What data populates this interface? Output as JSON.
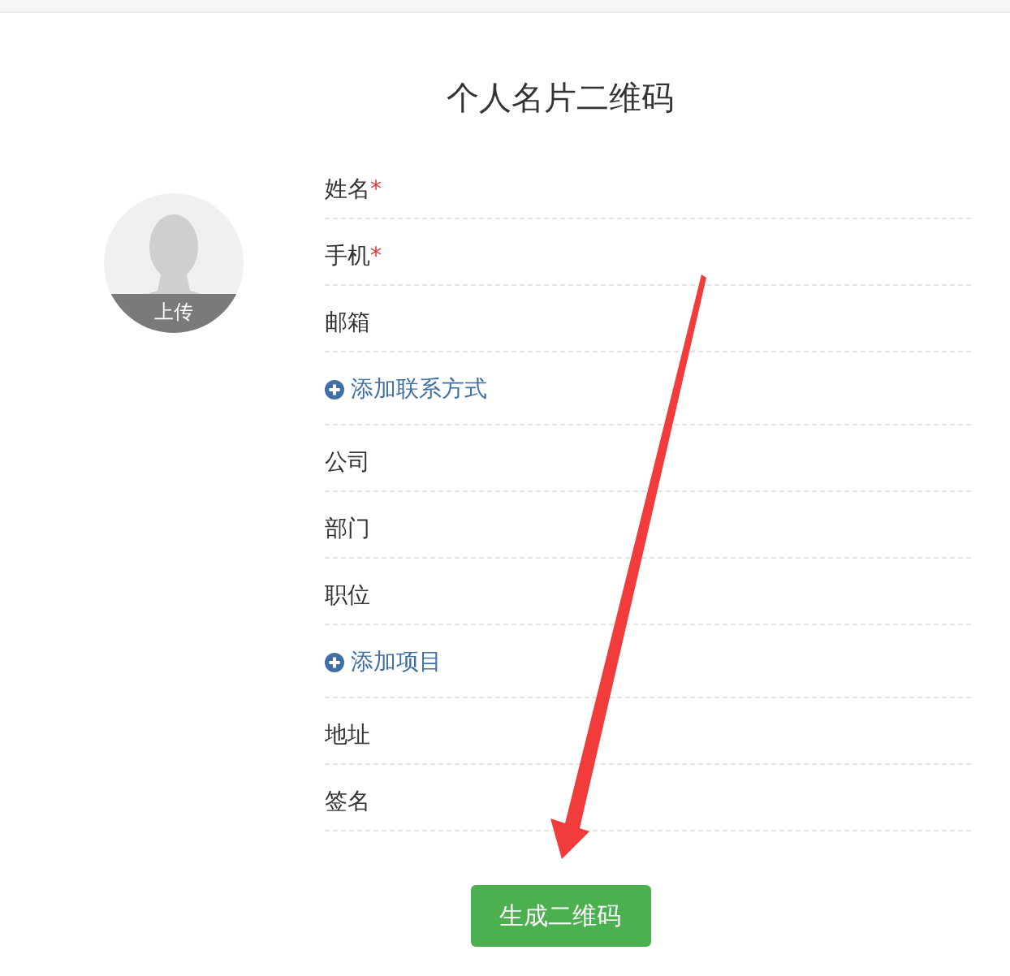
{
  "title": "个人名片二维码",
  "avatar": {
    "caption": "上传"
  },
  "fields": [
    {
      "kind": "field",
      "label": "姓名",
      "required_mark": "*"
    },
    {
      "kind": "field",
      "label": "手机",
      "required_mark": "*"
    },
    {
      "kind": "field",
      "label": "邮箱"
    },
    {
      "kind": "add_link",
      "label": "添加联系方式"
    },
    {
      "kind": "field",
      "label": "公司"
    },
    {
      "kind": "field",
      "label": "部门"
    },
    {
      "kind": "field",
      "label": "职位"
    },
    {
      "kind": "add_link",
      "label": "添加项目"
    },
    {
      "kind": "field",
      "label": "地址"
    },
    {
      "kind": "field",
      "label": "签名"
    }
  ],
  "submit_button": {
    "label": "生成二维码"
  }
}
